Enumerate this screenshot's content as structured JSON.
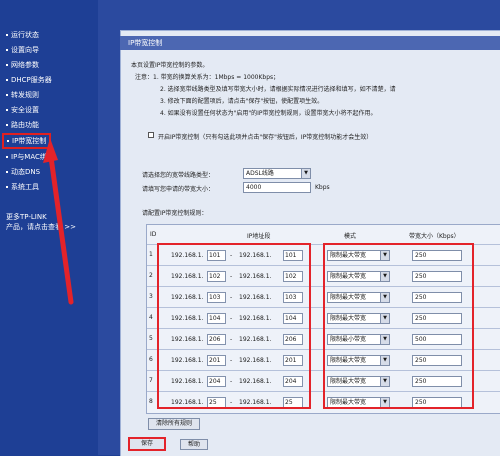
{
  "sidebar": {
    "items": [
      {
        "label": "运行状态"
      },
      {
        "label": "设置向导"
      },
      {
        "label": "网络参数"
      },
      {
        "label": "DHCP服务器"
      },
      {
        "label": "转发规则"
      },
      {
        "label": "安全设置"
      },
      {
        "label": "路由功能"
      },
      {
        "label": "IP带宽控制"
      },
      {
        "label": "IP与MAC绑定"
      },
      {
        "label": "动态DNS"
      },
      {
        "label": "系统工具"
      }
    ],
    "more_line1": "更多TP-LINK",
    "more_line2": "产品，请点击查看 >>"
  },
  "panel": {
    "title": "IP带宽控制",
    "intro": "本页设置IP带宽控制的参数。",
    "notes": [
      "注意：1. 带宽的换算关系为：1Mbps = 1000Kbps；",
      "2. 选择宽带线路类型及填写带宽大小时，请根据实际情况进行选择和填写，如不清楚，请",
      "3. 修改下面的配置项后，请点击\"保存\"按钮，使配置项生效。",
      "4. 如果没有设置任何状态为\"启用\"的IP带宽控制规则，设置带宽大小将不起作用。"
    ],
    "enable_label": "开启IP带宽控制（只有勾选此项并点击\"保存\"按钮后，IP带宽控制功能才会生效）",
    "line_type_label": "请选择您的宽带线路类型：",
    "line_type_value": "ADSL线路",
    "bandwidth_label": "请填写您申请的带宽大小：",
    "bandwidth_value": "4000",
    "bandwidth_unit": "Kbps",
    "rules_label": "请配置IP带宽控制规则："
  },
  "table": {
    "headers": {
      "id": "ID",
      "ip": "IP地址段",
      "mode": "模式",
      "bw": "带宽大小（Kbps）"
    },
    "ip_prefix": "192.168.1.",
    "rows": [
      {
        "id": "1",
        "start": "101",
        "end": "101",
        "mode": "限制最大带宽",
        "bw": "250"
      },
      {
        "id": "2",
        "start": "102",
        "end": "102",
        "mode": "限制最大带宽",
        "bw": "250"
      },
      {
        "id": "3",
        "start": "103",
        "end": "103",
        "mode": "限制最大带宽",
        "bw": "250"
      },
      {
        "id": "4",
        "start": "104",
        "end": "104",
        "mode": "限制最大带宽",
        "bw": "250"
      },
      {
        "id": "5",
        "start": "206",
        "end": "206",
        "mode": "限制最小带宽",
        "bw": "500"
      },
      {
        "id": "6",
        "start": "201",
        "end": "201",
        "mode": "限制最大带宽",
        "bw": "250"
      },
      {
        "id": "7",
        "start": "204",
        "end": "204",
        "mode": "限制最大带宽",
        "bw": "250"
      },
      {
        "id": "8",
        "start": "25",
        "end": "25",
        "mode": "限制最大带宽",
        "bw": "250"
      }
    ]
  },
  "buttons": {
    "clear_all": "清除所有规则",
    "save": "保存",
    "help": "帮助"
  }
}
